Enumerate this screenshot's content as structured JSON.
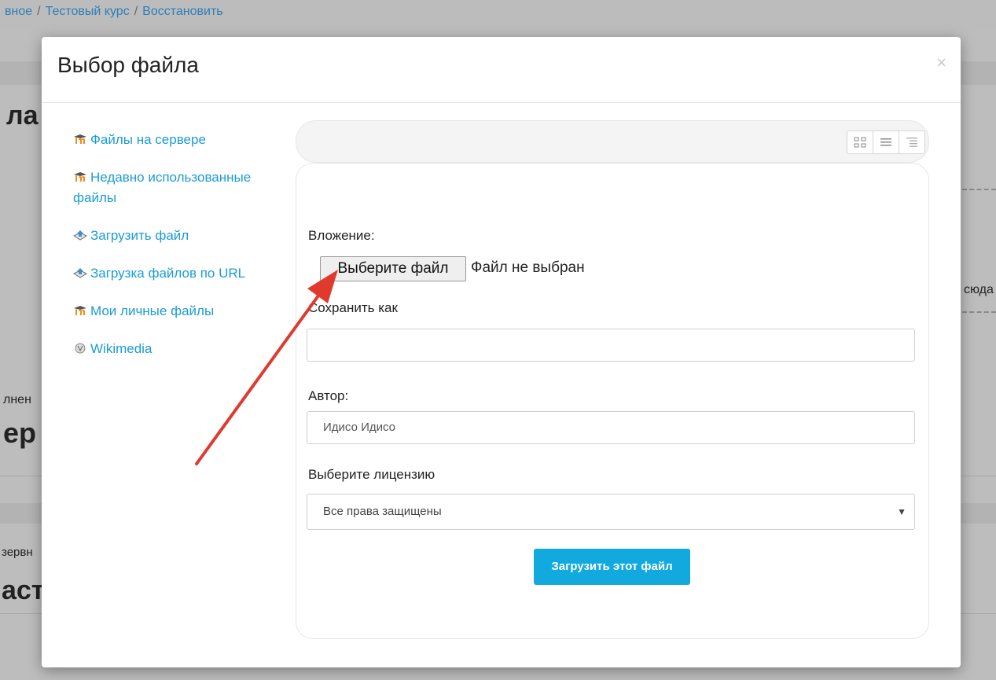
{
  "breadcrumb": {
    "items": [
      "вное",
      "Тестовый курс",
      "Восстановить"
    ],
    "separator": "/"
  },
  "background_fragments": {
    "left_heading_1": "ла",
    "left_text_1": "лнен",
    "left_heading_2": "ер",
    "left_text_2": "зервн",
    "left_heading_3": "аст",
    "right_text": "сюда"
  },
  "dialog": {
    "title": "Выбор файла",
    "close_label": "×"
  },
  "repositories": [
    {
      "label": "Файлы на сервере",
      "icon": "moodle-icon"
    },
    {
      "label": "Недавно использованные файлы",
      "icon": "moodle-icon"
    },
    {
      "label": "Загрузить файл",
      "icon": "upload-icon"
    },
    {
      "label": "Загрузка файлов по URL",
      "icon": "upload-icon"
    },
    {
      "label": "Мои личные файлы",
      "icon": "moodle-icon"
    },
    {
      "label": "Wikimedia",
      "icon": "wikimedia-icon"
    }
  ],
  "view_modes": [
    "grid-view-icon",
    "list-view-icon",
    "tree-view-icon"
  ],
  "form": {
    "attachment_label": "Вложение:",
    "choose_file_button": "Выберите файл",
    "file_status": "Файл не выбран",
    "save_as_label": "Сохранить как",
    "save_as_value": "",
    "author_label": "Автор:",
    "author_value": "Идисо Идисо",
    "license_label": "Выберите лицензию",
    "license_value": "Все права защищены",
    "submit_label": "Загрузить этот файл"
  },
  "colors": {
    "link": "#1a9cd6",
    "primary_button": "#12a9df",
    "annotation_arrow": "#e03a2f"
  }
}
